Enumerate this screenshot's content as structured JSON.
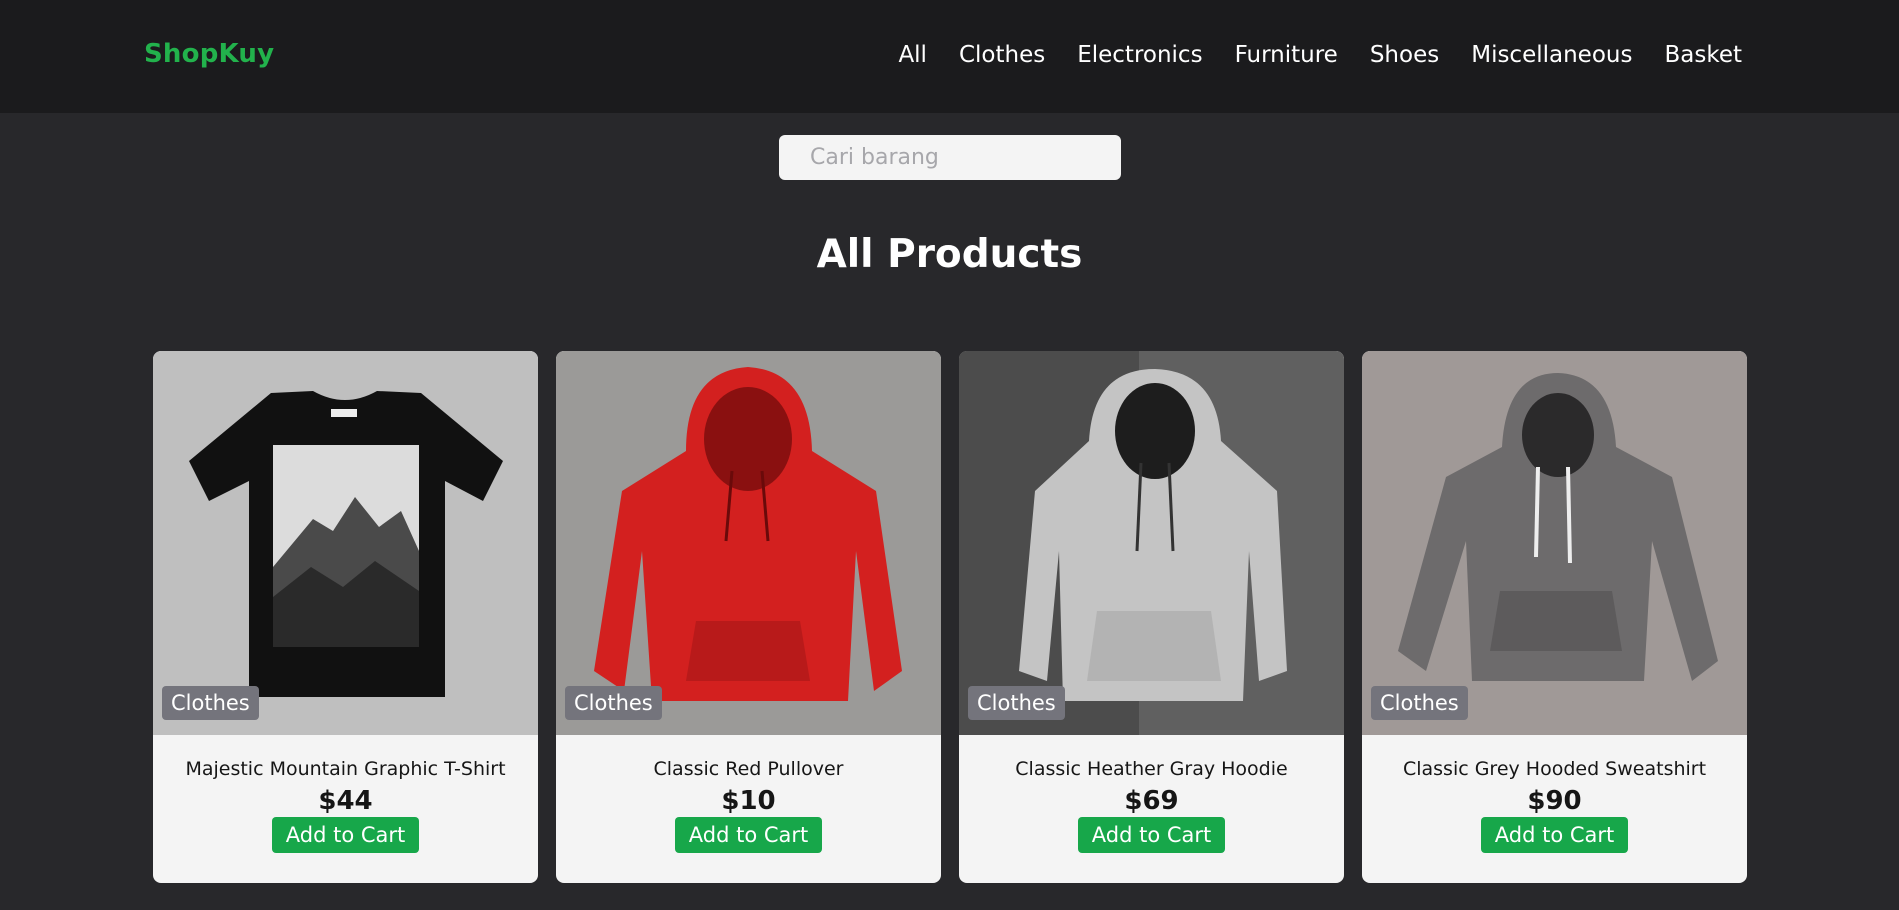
{
  "brand": {
    "name": "ShopKuy"
  },
  "nav": {
    "items": [
      {
        "label": "All"
      },
      {
        "label": "Clothes"
      },
      {
        "label": "Electronics"
      },
      {
        "label": "Furniture"
      },
      {
        "label": "Shoes"
      },
      {
        "label": "Miscellaneous"
      },
      {
        "label": "Basket"
      }
    ]
  },
  "search": {
    "placeholder": "Cari barang",
    "value": ""
  },
  "page": {
    "title": "All Products"
  },
  "products": [
    {
      "category": "Clothes",
      "name": "Majestic Mountain Graphic T-Shirt",
      "price": "$44",
      "cta": "Add to Cart",
      "image": "black-tshirt-mountain-print"
    },
    {
      "category": "Clothes",
      "name": "Classic Red Pullover",
      "price": "$10",
      "cta": "Add to Cart",
      "image": "red-hoodie"
    },
    {
      "category": "Clothes",
      "name": "Classic Heather Gray Hoodie",
      "price": "$69",
      "cta": "Add to Cart",
      "image": "light-gray-hoodie"
    },
    {
      "category": "Clothes",
      "name": "Classic Grey Hooded Sweatshirt",
      "price": "$90",
      "cta": "Add to Cart",
      "image": "grey-hooded-sweatshirt"
    }
  ],
  "colors": {
    "brand_green": "#22b24c",
    "button_green": "#17a74a",
    "navbar_bg": "#1b1b1d",
    "page_bg": "#28282b",
    "badge_bg": "#74747c"
  }
}
